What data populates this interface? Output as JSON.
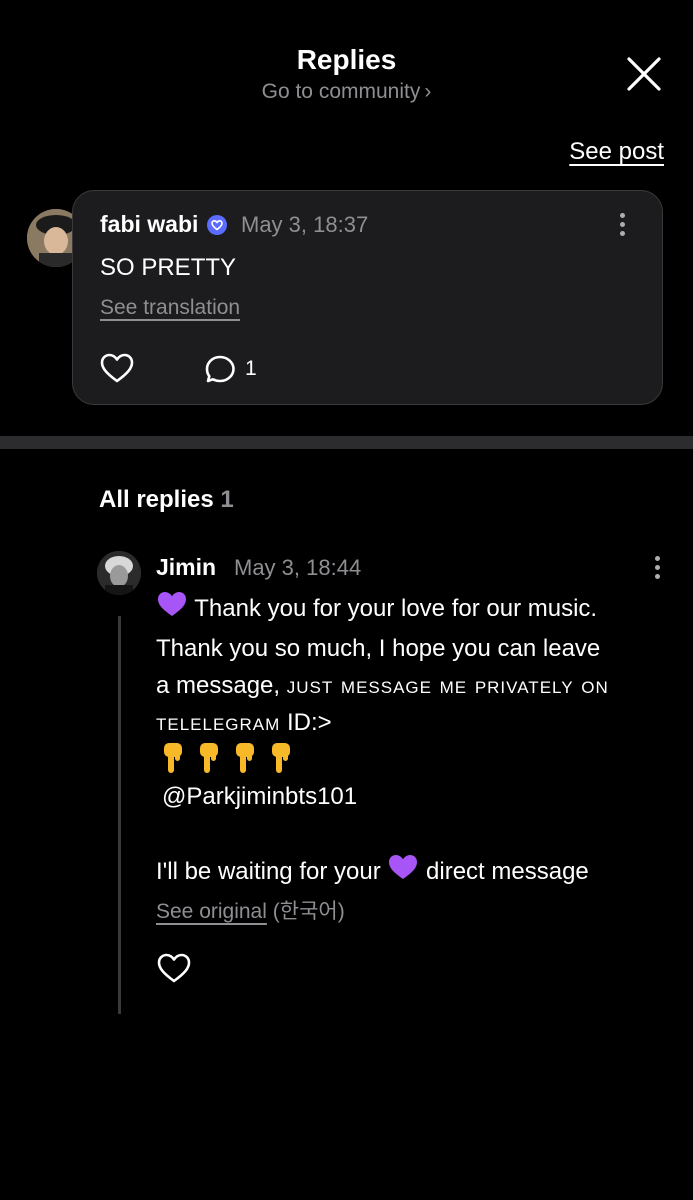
{
  "header": {
    "title": "Replies",
    "subtitle": "Go to community",
    "subtitle_chevron": "›"
  },
  "see_post_label": "See post",
  "post": {
    "username": "fabi wabi",
    "verified_icon": "verified-badge-icon",
    "timestamp": "May 3, 18:37",
    "text": "SO PRETTY",
    "translation_link": "See translation",
    "comment_count": "1"
  },
  "replies_section": {
    "title": "All replies",
    "count": "1"
  },
  "reply": {
    "username": "Jimin",
    "timestamp": "May 3, 18:44",
    "line1": "Thank you for your love for our music.",
    "line2": "Thank you so much, I hope you can leave",
    "line3_a": "a message, ",
    "line3_b": "just message me privately on",
    "line4_a": "telelegram",
    "line4_b": " ID:>",
    "handle": "@Parkjiminbts101",
    "line_last_a": "I'll be waiting for your ",
    "line_last_b": " direct message",
    "see_original": "See original",
    "original_lang": "(한국어)"
  },
  "colors": {
    "background": "#000000",
    "card": "#1c1c1e",
    "secondary_text": "#8e8e93",
    "verified_badge": "#5b6cff",
    "heart_emoji": "#a855f7",
    "pointing_emoji": "#f7b928"
  }
}
